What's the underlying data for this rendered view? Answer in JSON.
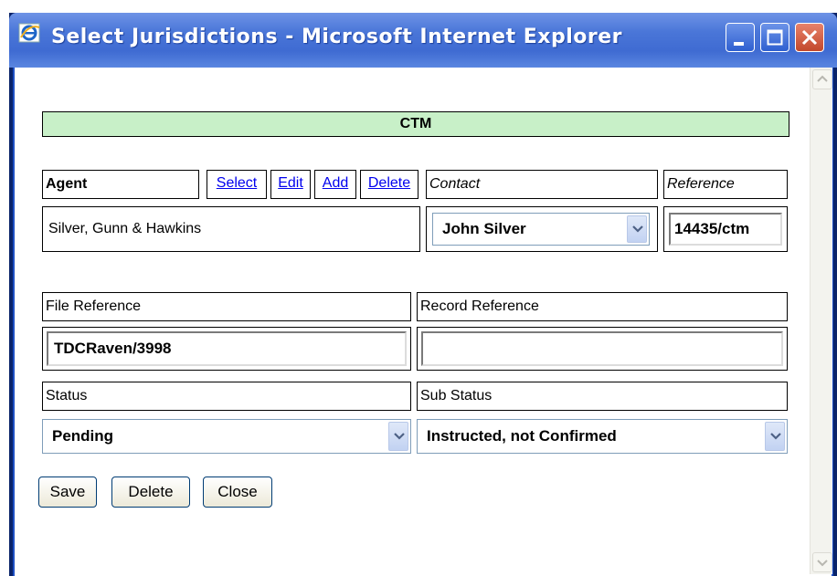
{
  "window": {
    "title": "Select Jurisdictions - Microsoft Internet Explorer",
    "icon": "internet-explorer-icon"
  },
  "header": {
    "jurisdiction": "CTM"
  },
  "agent": {
    "label": "Agent",
    "links": [
      "Select",
      "Edit",
      "Add",
      "Delete"
    ],
    "value": "Silver, Gunn & Hawkins"
  },
  "contact": {
    "label": "Contact",
    "selected": "John Silver"
  },
  "reference": {
    "label": "Reference",
    "value": "14435/ctm"
  },
  "file_reference": {
    "label": "File Reference",
    "value": "TDCRaven/3998"
  },
  "record_reference": {
    "label": "Record Reference",
    "value": ""
  },
  "status": {
    "label": "Status",
    "selected": "Pending"
  },
  "sub_status": {
    "label": "Sub Status",
    "selected": "Instructed, not Confirmed"
  },
  "buttons": {
    "save": "Save",
    "delete": "Delete",
    "close": "Close"
  },
  "colors": {
    "header_bg": "#c8f0c8",
    "titlebar": "#4a76d8",
    "link": "#0000ee"
  }
}
